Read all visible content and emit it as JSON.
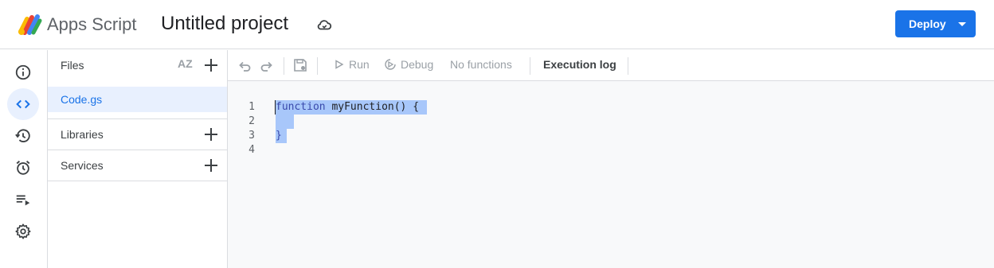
{
  "header": {
    "app_name": "Apps Script",
    "project_title": "Untitled project",
    "deploy_label": "Deploy"
  },
  "rail": {
    "items": [
      "overview-icon",
      "editor-icon",
      "triggers-history-icon",
      "alarm-icon",
      "executions-icon",
      "settings-icon"
    ]
  },
  "files_panel": {
    "files_label": "Files",
    "sort_label": "AZ",
    "file_name": "Code.gs",
    "libraries_label": "Libraries",
    "services_label": "Services"
  },
  "toolbar": {
    "run_label": "Run",
    "debug_label": "Debug",
    "function_select": "No functions",
    "execution_log_label": "Execution log"
  },
  "editor": {
    "lines": [
      {
        "number": "1",
        "text": "function myFunction() {"
      },
      {
        "number": "2",
        "text": ""
      },
      {
        "number": "3",
        "text": "}"
      },
      {
        "number": "4",
        "text": ""
      }
    ]
  },
  "colors": {
    "accent": "#1a73e8",
    "selection": "#a8c7fa",
    "editor_bg": "#f8f9fa"
  }
}
